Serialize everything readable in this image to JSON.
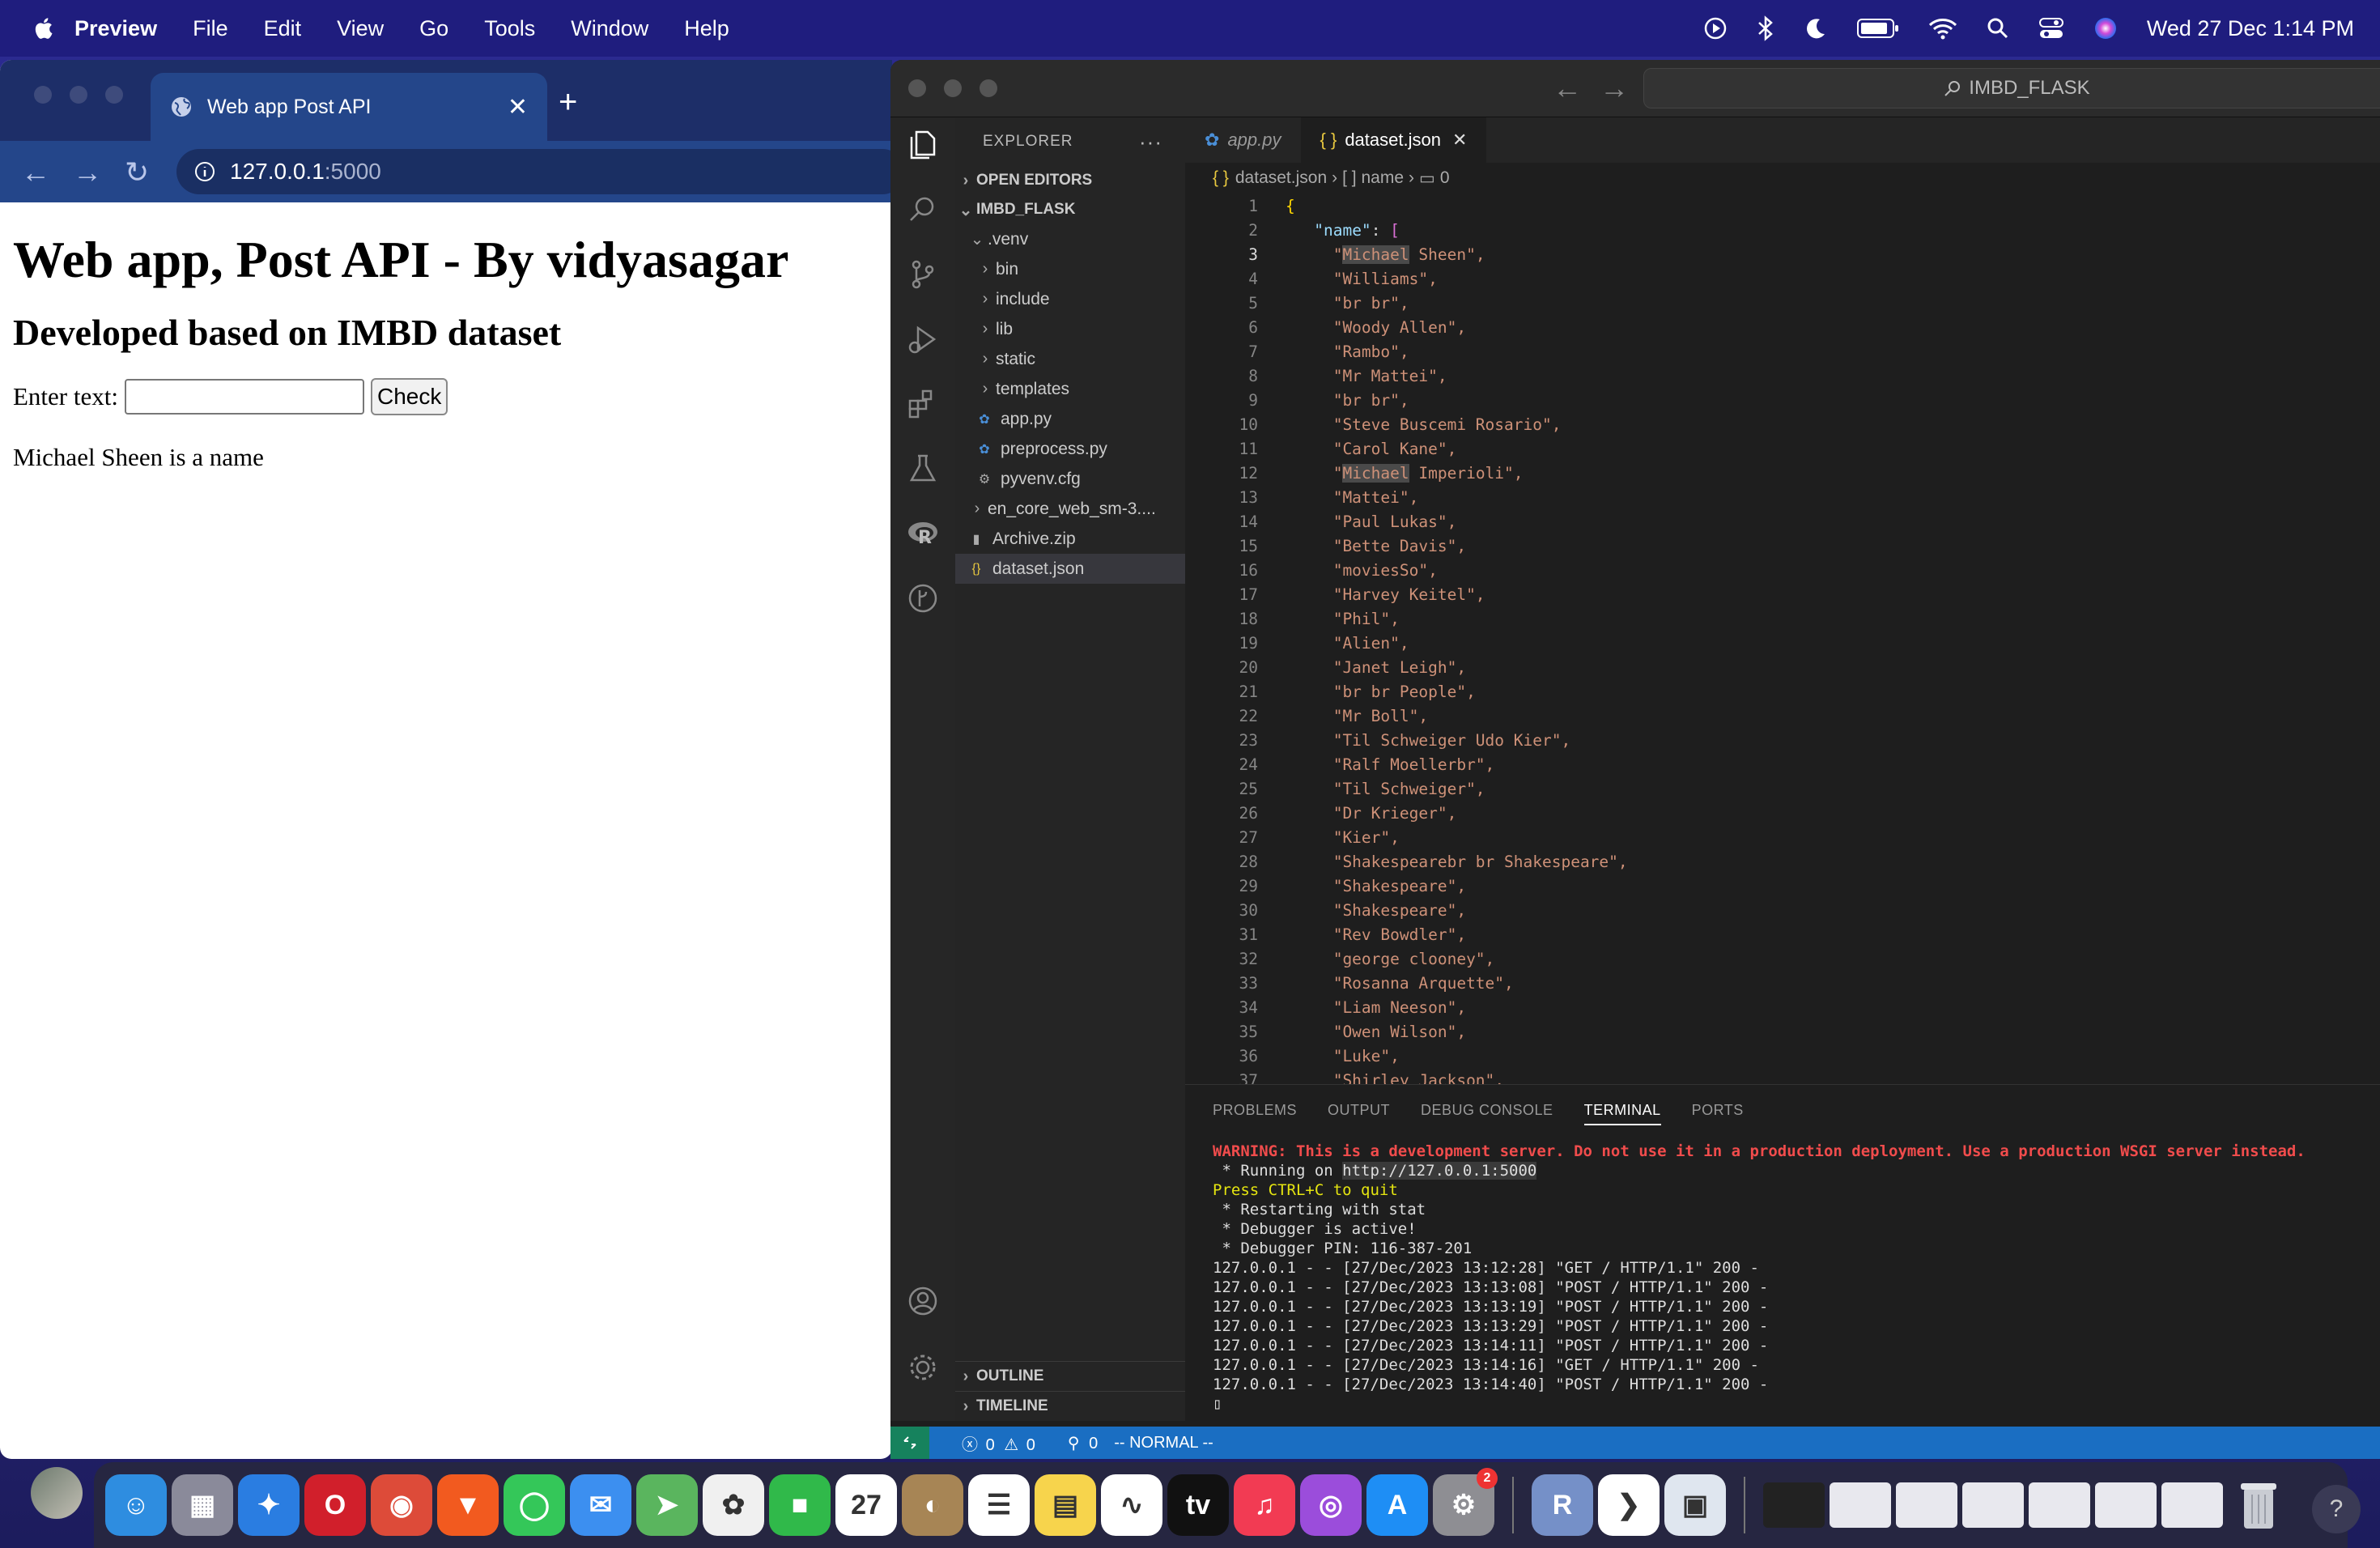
{
  "menubar": {
    "app_name": "Preview",
    "items": [
      "File",
      "Edit",
      "View",
      "Go",
      "Tools",
      "Window",
      "Help"
    ],
    "clock": "Wed 27 Dec  1:14 PM"
  },
  "browser": {
    "tab_title": "Web app Post API",
    "url_host": "127.0.0.1",
    "url_port": ":5000",
    "page": {
      "h1": "Web app, Post API - By vidyasagar",
      "h2": "Developed based on IMBD dataset",
      "input_label": "Enter text:",
      "input_value": "",
      "check_button": "Check",
      "result": "Michael Sheen is a name"
    }
  },
  "vscode": {
    "search_text": "IMBD_FLASK",
    "explorer_title": "EXPLORER",
    "open_editors": "OPEN EDITORS",
    "project": "IMBD_FLASK",
    "tree": [
      {
        "label": ".venv",
        "type": "folder-open",
        "indent": 1
      },
      {
        "label": "bin",
        "type": "folder",
        "indent": 2
      },
      {
        "label": "include",
        "type": "folder",
        "indent": 2
      },
      {
        "label": "lib",
        "type": "folder",
        "indent": 2
      },
      {
        "label": "static",
        "type": "folder",
        "indent": 2
      },
      {
        "label": "templates",
        "type": "folder",
        "indent": 2
      },
      {
        "label": "app.py",
        "type": "py",
        "indent": 2
      },
      {
        "label": "preprocess.py",
        "type": "py",
        "indent": 2
      },
      {
        "label": "pyvenv.cfg",
        "type": "cfg",
        "indent": 2
      },
      {
        "label": "en_core_web_sm-3....",
        "type": "folder",
        "indent": 1
      },
      {
        "label": "Archive.zip",
        "type": "zip",
        "indent": 1
      },
      {
        "label": "dataset.json",
        "type": "json",
        "indent": 1,
        "selected": true
      }
    ],
    "outline": "OUTLINE",
    "timeline": "TIMELINE",
    "tabs": [
      {
        "label": "app.py",
        "icon": "python-icon",
        "active": false
      },
      {
        "label": "dataset.json",
        "icon": "json-icon",
        "active": true
      }
    ],
    "breadcrumb": [
      "dataset.json",
      "[ ] name",
      "0"
    ],
    "code_lines": [
      {
        "n": "1",
        "kind": "open-brace"
      },
      {
        "n": "2",
        "kind": "key",
        "text": "\"name\": ["
      },
      {
        "n": "3",
        "kind": "str",
        "text": "\"Michael Sheen\",",
        "hl": "Michael"
      },
      {
        "n": "4",
        "kind": "str",
        "text": "\"Williams\","
      },
      {
        "n": "5",
        "kind": "str",
        "text": "\"br br\","
      },
      {
        "n": "6",
        "kind": "str",
        "text": "\"Woody Allen\","
      },
      {
        "n": "7",
        "kind": "str",
        "text": "\"Rambo\","
      },
      {
        "n": "8",
        "kind": "str",
        "text": "\"Mr Mattei\","
      },
      {
        "n": "9",
        "kind": "str",
        "text": "\"br br\","
      },
      {
        "n": "10",
        "kind": "str",
        "text": "\"Steve Buscemi Rosario\","
      },
      {
        "n": "11",
        "kind": "str",
        "text": "\"Carol Kane\","
      },
      {
        "n": "12",
        "kind": "str",
        "text": "\"Michael Imperioli\",",
        "hl": "Michael"
      },
      {
        "n": "13",
        "kind": "str",
        "text": "\"Mattei\","
      },
      {
        "n": "14",
        "kind": "str",
        "text": "\"Paul Lukas\","
      },
      {
        "n": "15",
        "kind": "str",
        "text": "\"Bette Davis\","
      },
      {
        "n": "16",
        "kind": "str",
        "text": "\"moviesSo\","
      },
      {
        "n": "17",
        "kind": "str",
        "text": "\"Harvey Keitel\","
      },
      {
        "n": "18",
        "kind": "str",
        "text": "\"Phil\","
      },
      {
        "n": "19",
        "kind": "str",
        "text": "\"Alien\","
      },
      {
        "n": "20",
        "kind": "str",
        "text": "\"Janet Leigh\","
      },
      {
        "n": "21",
        "kind": "str",
        "text": "\"br br People\","
      },
      {
        "n": "22",
        "kind": "str",
        "text": "\"Mr Boll\","
      },
      {
        "n": "23",
        "kind": "str",
        "text": "\"Til Schweiger Udo Kier\","
      },
      {
        "n": "24",
        "kind": "str",
        "text": "\"Ralf Moellerbr\","
      },
      {
        "n": "25",
        "kind": "str",
        "text": "\"Til Schweiger\","
      },
      {
        "n": "26",
        "kind": "str",
        "text": "\"Dr Krieger\","
      },
      {
        "n": "27",
        "kind": "str",
        "text": "\"Kier\","
      },
      {
        "n": "28",
        "kind": "str",
        "text": "\"Shakespearebr br Shakespeare\","
      },
      {
        "n": "29",
        "kind": "str",
        "text": "\"Shakespeare\","
      },
      {
        "n": "30",
        "kind": "str",
        "text": "\"Shakespeare\","
      },
      {
        "n": "31",
        "kind": "str",
        "text": "\"Rev Bowdler\","
      },
      {
        "n": "32",
        "kind": "str",
        "text": "\"george clooney\","
      },
      {
        "n": "33",
        "kind": "str",
        "text": "\"Rosanna Arquette\","
      },
      {
        "n": "34",
        "kind": "str",
        "text": "\"Liam Neeson\","
      },
      {
        "n": "35",
        "kind": "str",
        "text": "\"Owen Wilson\","
      },
      {
        "n": "36",
        "kind": "str",
        "text": "\"Luke\","
      },
      {
        "n": "37",
        "kind": "str",
        "text": "\"Shirley Jackson\","
      }
    ],
    "panel_tabs": [
      "PROBLEMS",
      "OUTPUT",
      "DEBUG CONSOLE",
      "TERMINAL",
      "PORTS"
    ],
    "terminal": {
      "warning": "WARNING: This is a development server. Do not use it in a production deployment. Use a production WSGI server instead.",
      "running_prefix": " * Running on ",
      "running_url": "http://127.0.0.1:5000",
      "quit": "Press CTRL+C to quit",
      "lines": [
        " * Restarting with stat",
        " * Debugger is active!",
        " * Debugger PIN: 116-387-201",
        "127.0.0.1 - - [27/Dec/2023 13:12:28] \"GET / HTTP/1.1\" 200 -",
        "127.0.0.1 - - [27/Dec/2023 13:13:08] \"POST / HTTP/1.1\" 200 -",
        "127.0.0.1 - - [27/Dec/2023 13:13:19] \"POST / HTTP/1.1\" 200 -",
        "127.0.0.1 - - [27/Dec/2023 13:13:29] \"POST / HTTP/1.1\" 200 -",
        "127.0.0.1 - - [27/Dec/2023 13:14:11] \"POST / HTTP/1.1\" 200 -",
        "127.0.0.1 - - [27/Dec/2023 13:14:16] \"GET / HTTP/1.1\" 200 -",
        "127.0.0.1 - - [27/Dec/2023 13:14:40] \"POST / HTTP/1.1\" 200 -"
      ]
    },
    "status": {
      "errors": "0",
      "warnings": "0",
      "ports": "0",
      "mode": "-- NORMAL --"
    }
  },
  "dock": {
    "apps": [
      {
        "name": "finder-icon",
        "color": "#2e8de0",
        "glyph": "☺"
      },
      {
        "name": "launchpad-icon",
        "color": "#8a8a9a",
        "glyph": "▦"
      },
      {
        "name": "safari-icon",
        "color": "#2a7de1",
        "glyph": "✦"
      },
      {
        "name": "opera-icon",
        "color": "#d11f2b",
        "glyph": "O"
      },
      {
        "name": "chrome-icon",
        "color": "#dd4b39",
        "glyph": "◉"
      },
      {
        "name": "brave-icon",
        "color": "#f25a1f",
        "glyph": "▼"
      },
      {
        "name": "messages-icon",
        "color": "#34c759",
        "glyph": "◯"
      },
      {
        "name": "mail-icon",
        "color": "#3c8ff0",
        "glyph": "✉"
      },
      {
        "name": "maps-icon",
        "color": "#5ab55e",
        "glyph": "➤"
      },
      {
        "name": "photos-icon",
        "color": "#f0f0f0",
        "glyph": "✿"
      },
      {
        "name": "facetime-icon",
        "color": "#30b94a",
        "glyph": "■"
      },
      {
        "name": "calendar-icon",
        "color": "#ffffff",
        "glyph": "27"
      },
      {
        "name": "contacts-icon",
        "color": "#a78555",
        "glyph": "◐"
      },
      {
        "name": "reminders-icon",
        "color": "#ffffff",
        "glyph": "☰"
      },
      {
        "name": "notes-icon",
        "color": "#f7d44c",
        "glyph": "▤"
      },
      {
        "name": "freeform-icon",
        "color": "#ffffff",
        "glyph": "∿"
      },
      {
        "name": "appletv-icon",
        "color": "#111111",
        "glyph": "tv"
      },
      {
        "name": "music-icon",
        "color": "#f23b53",
        "glyph": "♫"
      },
      {
        "name": "podcasts-icon",
        "color": "#9b4ddb",
        "glyph": "◎"
      },
      {
        "name": "appstore-icon",
        "color": "#1e8ef5",
        "glyph": "A"
      },
      {
        "name": "settings-icon",
        "color": "#8e8e93",
        "glyph": "⚙",
        "badge": "2"
      },
      {
        "name": "rstudio-icon",
        "color": "#7590c8",
        "glyph": "R"
      },
      {
        "name": "vscode-icon",
        "color": "#ffffff",
        "glyph": "❯"
      },
      {
        "name": "preview-icon",
        "color": "#dfe6ef",
        "glyph": "▣"
      }
    ],
    "help": "?"
  }
}
